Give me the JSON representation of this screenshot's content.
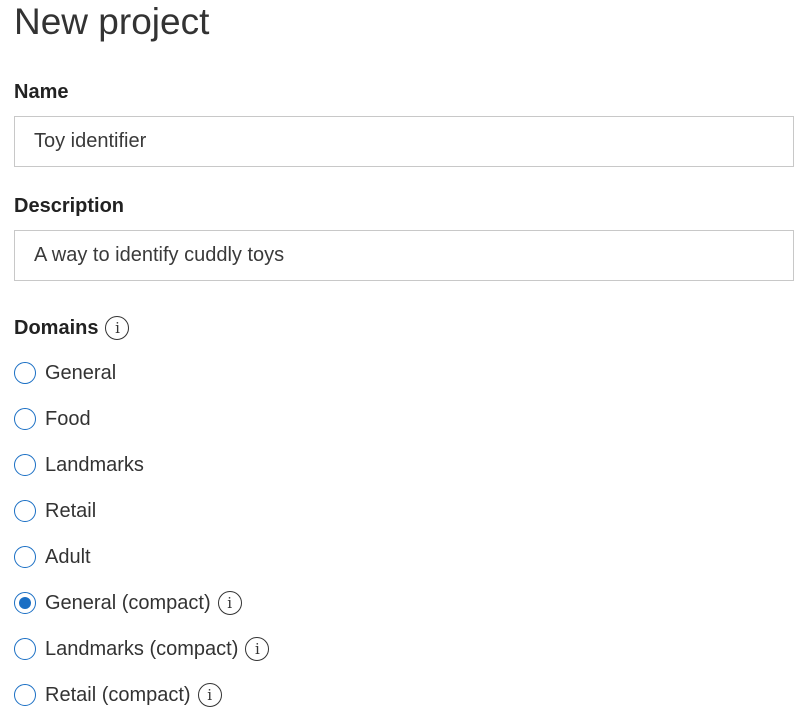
{
  "page": {
    "title": "New project"
  },
  "name_field": {
    "label": "Name",
    "value": "Toy identifier"
  },
  "description_field": {
    "label": "Description",
    "value": "A way to identify cuddly toys"
  },
  "domains": {
    "label": "Domains",
    "info_icon": "info-icon",
    "selected": "General (compact)",
    "options": [
      {
        "label": "General",
        "selected": false,
        "has_info": false
      },
      {
        "label": "Food",
        "selected": false,
        "has_info": false
      },
      {
        "label": "Landmarks",
        "selected": false,
        "has_info": false
      },
      {
        "label": "Retail",
        "selected": false,
        "has_info": false
      },
      {
        "label": "Adult",
        "selected": false,
        "has_info": false
      },
      {
        "label": "General (compact)",
        "selected": true,
        "has_info": true
      },
      {
        "label": "Landmarks (compact)",
        "selected": false,
        "has_info": true
      },
      {
        "label": "Retail (compact)",
        "selected": false,
        "has_info": true
      }
    ]
  },
  "colors": {
    "accent": "#1a6fc4",
    "text": "#333333",
    "input_border": "#c8c8c8"
  }
}
